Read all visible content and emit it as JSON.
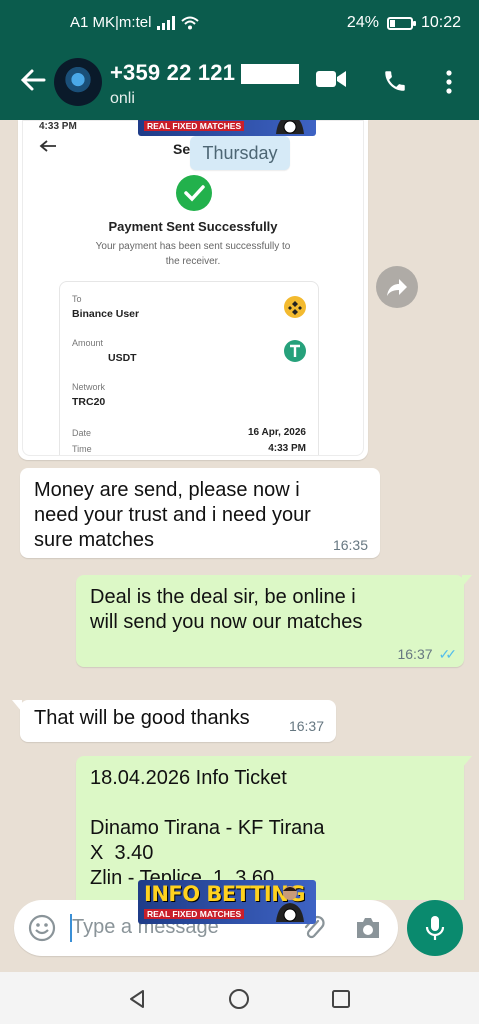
{
  "status_bar": {
    "carrier": "A1 MK|m:tel",
    "battery": "24%",
    "battery_level": 0.24,
    "time": "10:22"
  },
  "header": {
    "contact_name": "+359 22 121",
    "contact_status": "onli",
    "icons": [
      "back-arrow-icon",
      "video-call-icon",
      "phone-icon",
      "more-vert-icon"
    ]
  },
  "watermark": {
    "main": "INFO BETTING",
    "sub": "REAL FIXED MATCHES"
  },
  "image_message": {
    "inner_time": "4:33 PM",
    "inner_title": "Se",
    "payment_title": "Payment Sent Successfully",
    "payment_sub": "Your payment has been sent successfully to the receiver.",
    "to_label": "To",
    "to_value": "Binance User",
    "amount_label": "Amount",
    "amount_value": "USDT",
    "network_label": "Network",
    "network_value": "TRC20",
    "date_label": "Date",
    "date_value": "16 Apr, 2026",
    "time_label": "Time",
    "time_value": "4:33 PM"
  },
  "date_chip": "Thursday",
  "messages": [
    {
      "direction": "in",
      "text": "Money are send, please now i need your trust and i need your sure matches",
      "time": "16:35"
    },
    {
      "direction": "out",
      "text": "Deal is the deal sir, be online i will send you now our matches",
      "time": "16:37",
      "read": true
    },
    {
      "direction": "in",
      "text": "That will be good thanks",
      "time": "16:37"
    },
    {
      "direction": "out",
      "lines": [
        "18.04.2026 Info Ticket",
        "",
        "Dinamo Tirana - KF Tirana",
        "X  3.40",
        "Zlin - Teplice  1  3.60"
      ]
    }
  ],
  "composer": {
    "placeholder": "Type a message"
  },
  "colors": {
    "header": "#0b5c4d",
    "outgoing_bubble": "#dcf8c6",
    "incoming_bubble": "#ffffff",
    "mic_button": "#0a8a6e",
    "read_ticks": "#53bdeb"
  }
}
